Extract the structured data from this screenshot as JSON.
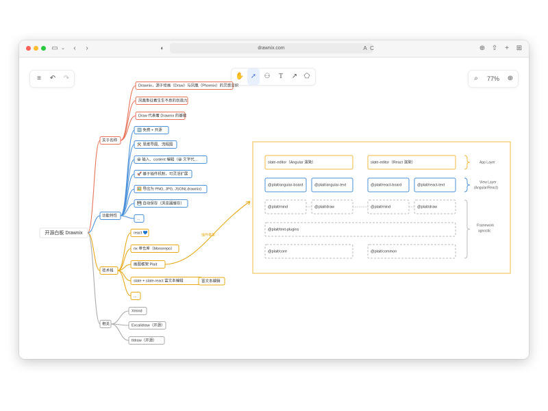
{
  "browser": {
    "url": "drawnix.com",
    "reader_label": "A",
    "refresh_label": "C"
  },
  "toolbar": {
    "zoom": "77%"
  },
  "mindmap": {
    "root": "开源白板 Drawnix",
    "branches": [
      {
        "label": "关于名称",
        "color": "#e8735a",
        "items": [
          "Drawnix，源于绘画（Draw）与凤凰（Phoenix）的灵感交织",
          "凤凰象征着生生不息的创造力",
          "Draw 代表着 Drawnix 的基础"
        ]
      },
      {
        "label": "功能特性",
        "color": "#4a90d9",
        "items": [
          "🆓 免费 + 开源",
          "⚒️ 思维导图、流程图",
          "😀 插入、content 编辑（😀 文字代…",
          "🚀 基于插件机制，可灵活扩展",
          "🖼️ 导出为 PNG, JPG, JSON(.drawnix)",
          "💾 自动保存（浏览器缓存）",
          "..."
        ]
      },
      {
        "label": "技术栈",
        "color": "#e6a817",
        "items": [
          "react 💙",
          "nx 单仓库（Monorepo）",
          "画图框架 Plait",
          "slate + slate-react 富文本编辑",
          "..."
        ],
        "sub_item": "富文本编辑",
        "link_label": "插件框架"
      },
      {
        "label": "相关",
        "color": "#aaaaaa",
        "items": [
          "Xmind",
          "Excalidraw（开源）",
          "tldraw（开源）"
        ]
      }
    ]
  },
  "architecture": {
    "app_layer": {
      "boxes": [
        "slate-editor（Angular 渲染）",
        "slate-editor（React 渲染）"
      ],
      "label": "App Layer"
    },
    "view_layer": {
      "boxes": [
        "@plait/angular-board",
        "@plait/angular-text",
        "@plait/react-board",
        "@plait/react-text"
      ],
      "label": "View Layer",
      "sublabel": "(Angular/React)"
    },
    "framework": {
      "row1": [
        "@plait/mind",
        "@plait/draw",
        "@plait/mind",
        "@plait/draw"
      ],
      "core": "@plait/text-plugins",
      "row3": [
        "@plait/core",
        "@plait/common"
      ],
      "label": "Framework",
      "sublabel": "agnostic"
    }
  },
  "colors": {
    "accent": "#4a7ad6",
    "orange": "#e8735a",
    "blue": "#4a90d9",
    "yellow": "#e6a817",
    "gray": "#aaaaaa",
    "arch_border": "#f0b840"
  },
  "icons": [
    "sidebar-icon",
    "chevron-down-icon",
    "back-icon",
    "forward-icon",
    "shield-icon",
    "translate-icon",
    "download-icon",
    "share-icon",
    "new-tab-icon",
    "tabs-icon",
    "menu-icon",
    "undo-icon",
    "redo-icon",
    "hand-icon",
    "pointer-icon",
    "mindmap-icon",
    "text-icon",
    "arrow-icon",
    "shape-icon",
    "zoom-out-icon",
    "zoom-in-icon"
  ]
}
